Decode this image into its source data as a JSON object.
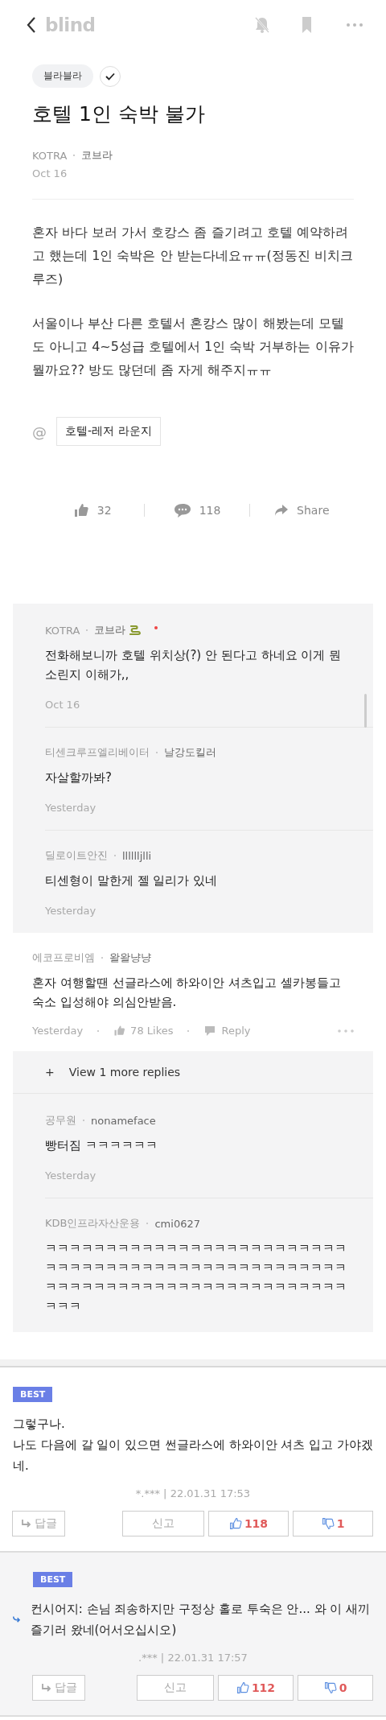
{
  "header": {
    "logo": "blind"
  },
  "post": {
    "category": "블라블라",
    "verified": true,
    "title": "호텔 1인 숙박 불가",
    "company": "KOTRA",
    "nickname": "코브라",
    "date": "Oct 16",
    "paragraphs": [
      "혼자 바다 보러 가서 호캉스 좀 즐기려고 호텔 예약하려고 했는데 1인 숙박은 안 받는다네요ㅠㅠ(정동진 비치크루즈)",
      "서울이나 부산 다른 호텔서 혼캉스 많이 해봤는데 모텔도 아니고 4~5성급 호텔에서 1인 숙박 거부하는 이유가 뭘까요?? 방도 많던데 좀 자게 해주지ㅠㅠ"
    ],
    "topic_mark": "@",
    "topic": "호텔-레저 라운지",
    "actions": [
      {
        "kind": "like",
        "label": "32"
      },
      {
        "kind": "comment",
        "label": "118"
      },
      {
        "kind": "share",
        "label": "Share"
      }
    ]
  },
  "thread": [
    {
      "company": "KOTRA",
      "nickname": "코브라",
      "snake": true,
      "author_dot": true,
      "text": "전화해보니까 호텔 위치상(?) 안 된다고 하네요 이게 뭔소린지 이해가,,",
      "date": "Oct 16"
    },
    {
      "company": "티센크루프엘리베이터",
      "nickname": "날강도킬러",
      "snake": false,
      "author_dot": false,
      "text": "자살할까봐?",
      "date": "Yesterday"
    },
    {
      "company": "딜로이트안진",
      "nickname": "lllllljlli",
      "snake": false,
      "author_dot": false,
      "text": "티센형이 말한게 젤 일리가 있네",
      "date": "Yesterday"
    }
  ],
  "comment": {
    "company": "에코프로비엠",
    "nickname": "왈왈냥냥",
    "text": "혼자 여행할땐 선글라스에 하와이안 셔츠입고 셀카봉들고 숙소 입성해야 의심안받음.",
    "date": "Yesterday",
    "likes": "78 Likes",
    "reply": "Reply"
  },
  "more_replies": {
    "mark": "+",
    "label": "View 1 more replies"
  },
  "replies": [
    {
      "company": "공무원",
      "nickname": "nonameface",
      "text": "빵터짐 ㅋㅋㅋㅋㅋㅋ",
      "date": "Yesterday"
    },
    {
      "company": "KDB인프라자산운용",
      "nickname": "cmi0627",
      "text": "ㅋㅋㅋㅋㅋㅋㅋㅋㅋㅋㅋㅋㅋㅋㅋㅋㅋㅋㅋㅋㅋㅋㅋㅋㅋㅋㅋㅋㅋㅋㅋㅋㅋㅋㅋㅋㅋㅋㅋㅋㅋㅋㅋㅋㅋㅋㅋㅋㅋㅋㅋㅋㅋㅋㅋㅋㅋㅋㅋㅋㅋㅋㅋㅋㅋㅋㅋㅋㅋㅋㅋㅋㅋㅋㅋㅋㅋㅋ"
    }
  ],
  "best_comments": [
    {
      "badge": "BEST",
      "is_reply": false,
      "text": "그렇구나.\n나도 다음에 갈 일이 있으면 썬글라스에 하와이안 셔츠 입고 가야겠네.",
      "meta": "*.*** | 22.01.31 17:53",
      "reply_button": "답글",
      "report": "신고",
      "up": "118",
      "down": "1"
    },
    {
      "badge": "BEST",
      "is_reply": true,
      "text": "컨시어지: 손님 죄송하지만 구정상 홀로 투숙은 안... 와 이 새끼 즐기러 왔네(어서오십시오)",
      "meta": ".*** | 22.01.31 17:57",
      "reply_button": "답글",
      "report": "신고",
      "up": "112",
      "down": "0"
    }
  ]
}
